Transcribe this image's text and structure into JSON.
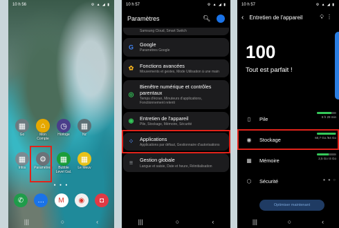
{
  "panel1": {
    "status_time": "10 h 56",
    "status_icons": "⚙ ▲ ◢ ▮",
    "apps_row1": [
      {
        "label": "Go",
        "icon": "google-folder-icon",
        "color": "#6c7a80"
      },
      {
        "label": "Mon Compte",
        "icon": "house-icon",
        "color": "#e6a800"
      },
      {
        "label": "Horloge",
        "icon": "clock-icon",
        "color": "#4a3e8a"
      },
      {
        "label": "Nz",
        "icon": "nz-folder-icon",
        "color": "#5d6f75"
      }
    ],
    "apps_row2": [
      {
        "label": "Infos",
        "icon": "info-folder-icon",
        "color": "#7a8a92"
      },
      {
        "label": "Paramètres",
        "icon": "gear-icon",
        "color": "#6b7278"
      },
      {
        "label": "Bubble Level Gal.",
        "icon": "bubble-level-icon",
        "color": "#1a9d3a"
      },
      {
        "label": "Le Meuv",
        "icon": "le-meuv-icon",
        "color": "#e8c21a"
      }
    ],
    "page_dots": "● ● ●",
    "dock": [
      {
        "icon": "phone-icon",
        "color": "#1f9c4a",
        "glyph": "✆"
      },
      {
        "icon": "messages-icon",
        "color": "#1a73e8",
        "glyph": "…"
      },
      {
        "icon": "gmail-icon",
        "color": "#ffffff",
        "glyph": "M"
      },
      {
        "icon": "chrome-icon",
        "color": "#f0f0f0",
        "glyph": "◉"
      },
      {
        "icon": "camera-icon",
        "color": "#e03a45",
        "glyph": "◘"
      }
    ],
    "nav": [
      "|||",
      "○",
      "‹"
    ]
  },
  "panel2": {
    "status_time": "10 h 57",
    "status_icons": "⚙ ▲ ◢ ▮",
    "title": "Paramètres",
    "items": [
      {
        "title": "",
        "subtitle": "Samsung Cloud, Smart Switch",
        "icon": "cloud-icon",
        "glyph": "",
        "color": "#888"
      },
      {
        "title": "Google",
        "subtitle": "Paramètres Google",
        "icon": "google-icon",
        "glyph": "G",
        "color": "#4285f4"
      },
      {
        "title": "Fonctions avancées",
        "subtitle": "Mouvements et gestes, Mode Utilisation à une main",
        "icon": "advanced-features-icon",
        "glyph": "✿",
        "color": "#f2b01e"
      },
      {
        "title": "Bienêtre numérique et contrôles parentaux",
        "subtitle": "Temps d'écran, Minuteurs d'applications, Fonctionnement relenti",
        "icon": "digital-wellbeing-icon",
        "glyph": "◎",
        "color": "#34c759"
      },
      {
        "title": "Entretien de l'appareil",
        "subtitle": "Pile, Stockage, Mémoire, Sécurité",
        "icon": "device-care-icon",
        "glyph": "◉",
        "color": "#34c759"
      },
      {
        "title": "Applications",
        "subtitle": "Applications par défaut, Gestionnaire d'autorisations",
        "icon": "apps-icon",
        "glyph": "⁘",
        "color": "#4a8cf7"
      },
      {
        "title": "Gestion globale",
        "subtitle": "Langue et saisie, Date et heure, Réinitialisation",
        "icon": "general-management-icon",
        "glyph": "≡",
        "color": "#9aa0a6"
      }
    ],
    "nav": [
      "|||",
      "○",
      "‹"
    ]
  },
  "panel3": {
    "status_time": "10 h 57",
    "status_icons": "⚙ ▲ ◢ ▮",
    "title": "Entretien de l'appareil",
    "score": "100",
    "score_text": "Tout est parfait !",
    "rows": [
      {
        "label": "Pile",
        "value": "8 h 29 min",
        "fill": 0.75,
        "icon": "battery-icon",
        "glyph": "▯"
      },
      {
        "label": "Stockage",
        "value": "60,7 Go /64 Go",
        "fill": 0.95,
        "icon": "storage-icon",
        "glyph": "◉"
      },
      {
        "label": "Mémoire",
        "value": "2,5 Go /4 Go",
        "fill": 0.62,
        "icon": "memory-icon",
        "glyph": "▦"
      },
      {
        "label": "Sécurité",
        "value": "",
        "fill": null,
        "icon": "security-icon",
        "glyph": "⬡"
      }
    ],
    "button": "Optimiser maintenant",
    "nav": [
      "|||",
      "○",
      "‹"
    ],
    "accent": "#2a7de1"
  },
  "highlight_color": "#e2231a"
}
